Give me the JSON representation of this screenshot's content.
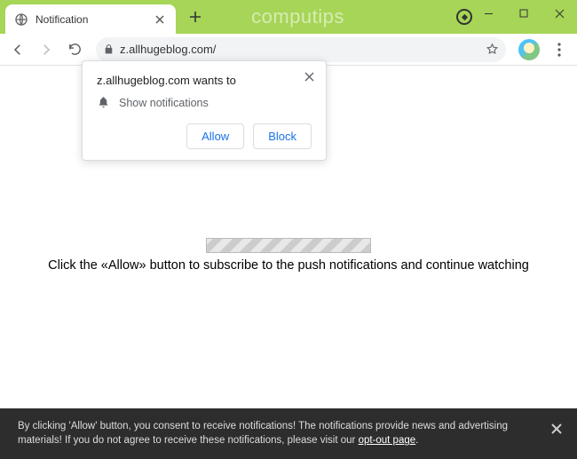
{
  "titlebar": {
    "tab_title": "Notification",
    "watermark": "computips"
  },
  "toolbar": {
    "url": "z.allhugeblog.com/"
  },
  "permission": {
    "title": "z.allhugeblog.com wants to",
    "request": "Show notifications",
    "allow_label": "Allow",
    "block_label": "Block"
  },
  "page": {
    "instruction": "Click the «Allow» button to subscribe to the push notifications and continue watching"
  },
  "banner": {
    "line1": "By clicking 'Allow' button, you consent to receive notifications! The notifications provide news and advertising materials! If",
    "line2a": "you do not agree to receive these notifications, please visit our ",
    "opt_out": "opt-out page",
    "line2b": "."
  }
}
